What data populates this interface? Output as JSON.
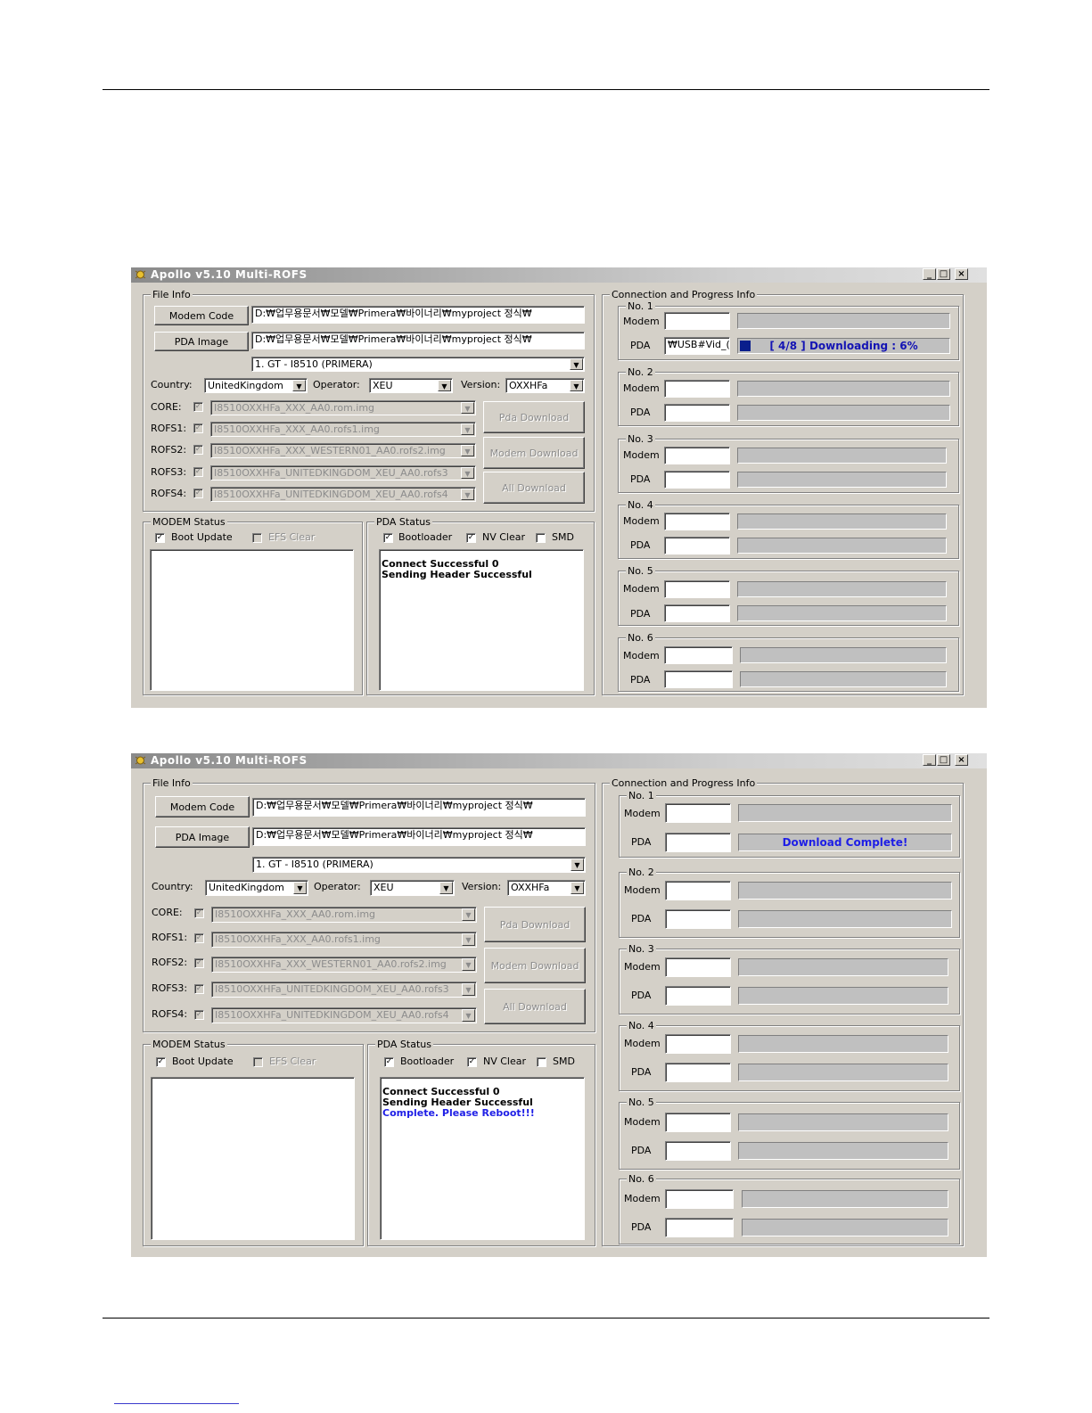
{
  "screens": [
    {
      "title": "Apollo v5.10 Multi-ROFS",
      "file_info": {
        "label": "File Info",
        "modem_code_button": "Modem Code",
        "modem_code_path": "D:₩업무용문서₩모델₩Primera₩바이너리₩myproject 정식₩",
        "pda_image_button": "PDA Image",
        "pda_image_path": "D:₩업무용문서₩모델₩Primera₩바이너리₩myproject 정식₩",
        "model_select": "1. GT - I8510 (PRIMERA)",
        "country_label": "Country:",
        "country_value": "UnitedKingdom",
        "operator_label": "Operator:",
        "operator_value": "XEU",
        "version_label": "Version:",
        "version_value": "OXXHFa",
        "rows": [
          {
            "label": "CORE:",
            "file": "I8510OXXHFa_XXX_AA0.rom.img"
          },
          {
            "label": "ROFS1:",
            "file": "I8510OXXHFa_XXX_AA0.rofs1.img"
          },
          {
            "label": "ROFS2:",
            "file": "I8510OXXHFa_XXX_WESTERN01_AA0.rofs2.img"
          },
          {
            "label": "ROFS3:",
            "file": "I8510OXXHFa_UNITEDKINGDOM_XEU_AA0.rofs3"
          },
          {
            "label": "ROFS4:",
            "file": "I8510OXXHFa_UNITEDKINGDOM_XEU_AA0.rofs4"
          }
        ],
        "pda_download": "Pda Download",
        "modem_download": "Modem Download",
        "all_download": "All Download"
      },
      "modem_status": {
        "label": "MODEM Status",
        "boot_update": "Boot Update",
        "efs_clear": "EFS Clear"
      },
      "pda_status": {
        "label": "PDA Status",
        "bootloader": "Bootloader",
        "nv_clear": "NV Clear",
        "smd": "SMD",
        "log": [
          "Connect Successful 0",
          "Sending Header Successful"
        ]
      },
      "connection": {
        "label": "Connection and Progress Info",
        "slots": [
          {
            "name": "No. 1",
            "modem": "Modem",
            "pda": "PDA",
            "pda_port": "₩USB#Vid_(",
            "pda_progress_text": "[ 4/8 ] Downloading : 6%",
            "pda_progress_percent": 6
          },
          {
            "name": "No. 2",
            "modem": "Modem",
            "pda": "PDA"
          },
          {
            "name": "No. 3",
            "modem": "Modem",
            "pda": "PDA"
          },
          {
            "name": "No. 4",
            "modem": "Modem",
            "pda": "PDA"
          },
          {
            "name": "No. 5",
            "modem": "Modem",
            "pda": "PDA"
          },
          {
            "name": "No. 6",
            "modem": "Modem",
            "pda": "PDA"
          }
        ]
      }
    },
    {
      "title": "Apollo v5.10 Multi-ROFS",
      "file_info": {
        "label": "File Info",
        "modem_code_button": "Modem Code",
        "modem_code_path": "D:₩업무용문서₩모델₩Primera₩바이너리₩myproject 정식₩",
        "pda_image_button": "PDA Image",
        "pda_image_path": "D:₩업무용문서₩모델₩Primera₩바이너리₩myproject 정식₩",
        "model_select": "1. GT - I8510 (PRIMERA)",
        "country_label": "Country:",
        "country_value": "UnitedKingdom",
        "operator_label": "Operator:",
        "operator_value": "XEU",
        "version_label": "Version:",
        "version_value": "OXXHFa",
        "rows": [
          {
            "label": "CORE:",
            "file": "I8510OXXHFa_XXX_AA0.rom.img"
          },
          {
            "label": "ROFS1:",
            "file": "I8510OXXHFa_XXX_AA0.rofs1.img"
          },
          {
            "label": "ROFS2:",
            "file": "I8510OXXHFa_XXX_WESTERN01_AA0.rofs2.img"
          },
          {
            "label": "ROFS3:",
            "file": "I8510OXXHFa_UNITEDKINGDOM_XEU_AA0.rofs3"
          },
          {
            "label": "ROFS4:",
            "file": "I8510OXXHFa_UNITEDKINGDOM_XEU_AA0.rofs4"
          }
        ],
        "pda_download": "Pda Download",
        "modem_download": "Modem Download",
        "all_download": "All Download"
      },
      "modem_status": {
        "label": "MODEM Status",
        "boot_update": "Boot Update",
        "efs_clear": "EFS Clear"
      },
      "pda_status": {
        "label": "PDA Status",
        "bootloader": "Bootloader",
        "nv_clear": "NV Clear",
        "smd": "SMD",
        "log": [
          "Connect Successful 0",
          "Sending Header Successful"
        ],
        "log_complete": "Complete. Please Reboot!!!"
      },
      "connection": {
        "label": "Connection and Progress Info",
        "slots": [
          {
            "name": "No. 1",
            "modem": "Modem",
            "pda": "PDA",
            "pda_progress_text": "Download Complete!",
            "pda_progress_percent": 100
          },
          {
            "name": "No. 2",
            "modem": "Modem",
            "pda": "PDA"
          },
          {
            "name": "No. 3",
            "modem": "Modem",
            "pda": "PDA"
          },
          {
            "name": "No. 4",
            "modem": "Modem",
            "pda": "PDA"
          },
          {
            "name": "No. 5",
            "modem": "Modem",
            "pda": "PDA"
          },
          {
            "name": "No. 6",
            "modem": "Modem",
            "pda": "PDA"
          }
        ]
      }
    }
  ],
  "colors": {
    "window_bg": "#d4d0c8",
    "progress_text": "#1414b4",
    "log_complete": "#1e1ee6"
  }
}
